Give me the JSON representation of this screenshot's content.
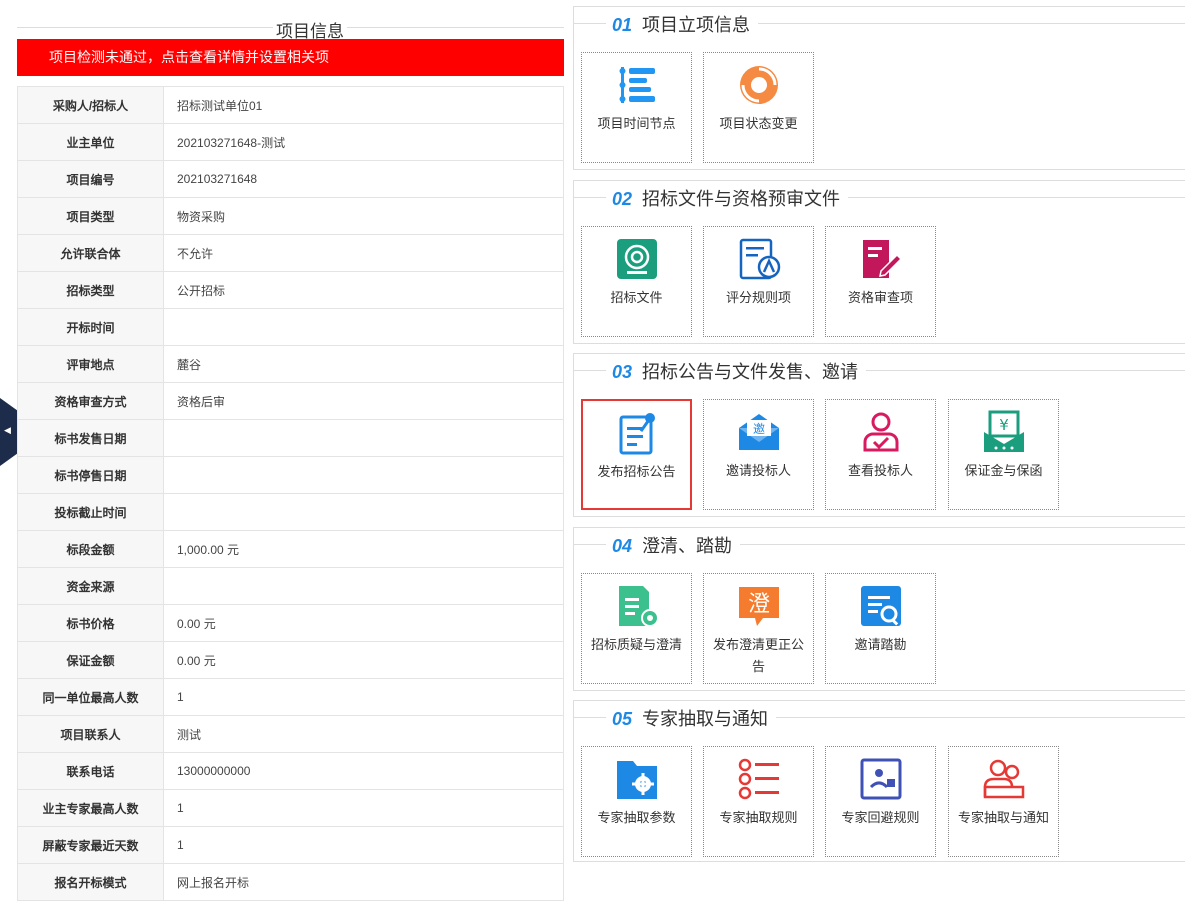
{
  "left": {
    "title": "项目信息",
    "alert": "项目检测未通过，点击查看详情并设置相关项",
    "rows": [
      {
        "k": "采购人/招标人",
        "v": "招标测试单位01"
      },
      {
        "k": "业主单位",
        "v": "202103271648-测试"
      },
      {
        "k": "项目编号",
        "v": "202103271648"
      },
      {
        "k": "项目类型",
        "v": "物资采购"
      },
      {
        "k": "允许联合体",
        "v": "不允许"
      },
      {
        "k": "招标类型",
        "v": "公开招标"
      },
      {
        "k": "开标时间",
        "v": ""
      },
      {
        "k": "评审地点",
        "v": "麓谷"
      },
      {
        "k": "资格审查方式",
        "v": "资格后审"
      },
      {
        "k": "标书发售日期",
        "v": ""
      },
      {
        "k": "标书停售日期",
        "v": ""
      },
      {
        "k": "投标截止时间",
        "v": ""
      },
      {
        "k": "标段金额",
        "v": "1,000.00 元"
      },
      {
        "k": "资金来源",
        "v": ""
      },
      {
        "k": "标书价格",
        "v": "0.00 元"
      },
      {
        "k": "保证金额",
        "v": "0.00 元"
      },
      {
        "k": "同一单位最高人数",
        "v": "1"
      },
      {
        "k": "项目联系人",
        "v": "测试"
      },
      {
        "k": "联系电话",
        "v": "13000000000"
      },
      {
        "k": "业主专家最高人数",
        "v": "1"
      },
      {
        "k": "屏蔽专家最近天数",
        "v": "1"
      },
      {
        "k": "报名开标模式",
        "v": "网上报名开标"
      }
    ]
  },
  "sections": [
    {
      "num": "01",
      "title": "项目立项信息",
      "tiles": [
        {
          "label": "项目时间节点",
          "icon": "timeline-icon",
          "color": "#2196f3"
        },
        {
          "label": "项目状态变更",
          "icon": "status-change-icon",
          "color": "#f58a42"
        }
      ]
    },
    {
      "num": "02",
      "title": "招标文件与资格预审文件",
      "tiles": [
        {
          "label": "招标文件",
          "icon": "target-doc-icon",
          "color": "#1b9e7e"
        },
        {
          "label": "评分规则项",
          "icon": "scoring-rules-icon",
          "color": "#1565c0"
        },
        {
          "label": "资格审查项",
          "icon": "qualification-review-icon",
          "color": "#c2185b"
        }
      ]
    },
    {
      "num": "03",
      "title": "招标公告与文件发售、邀请",
      "tiles": [
        {
          "label": "发布招标公告",
          "icon": "publish-notice-icon",
          "color": "#1e88e5",
          "selected": true
        },
        {
          "label": "邀请投标人",
          "icon": "invite-envelope-icon",
          "color": "#1e88e5",
          "glyph": "邀"
        },
        {
          "label": "查看投标人",
          "icon": "view-bidder-icon",
          "color": "#d81b60"
        },
        {
          "label": "保证金与保函",
          "icon": "deposit-icon",
          "color": "#1b9e7e",
          "glyph": "¥"
        }
      ]
    },
    {
      "num": "04",
      "title": "澄清、踏勘",
      "tiles": [
        {
          "label": "招标质疑与澄清",
          "icon": "query-clarify-icon",
          "color": "#3cc18e"
        },
        {
          "label": "发布澄清更正公告",
          "icon": "clarify-notice-icon",
          "color": "#f57c2f",
          "glyph": "澄"
        },
        {
          "label": "邀请踏勘",
          "icon": "site-survey-icon",
          "color": "#1e88e5"
        }
      ]
    },
    {
      "num": "05",
      "title": "专家抽取与通知",
      "tiles": [
        {
          "label": "专家抽取参数",
          "icon": "folder-gear-icon",
          "color": "#1e88e5"
        },
        {
          "label": "专家抽取规则",
          "icon": "list-rules-icon",
          "color": "#e53935"
        },
        {
          "label": "专家回避规则",
          "icon": "avoid-rules-icon",
          "color": "#3f51b5"
        },
        {
          "label": "专家抽取与通知",
          "icon": "expert-group-icon",
          "color": "#e53935"
        }
      ]
    }
  ]
}
